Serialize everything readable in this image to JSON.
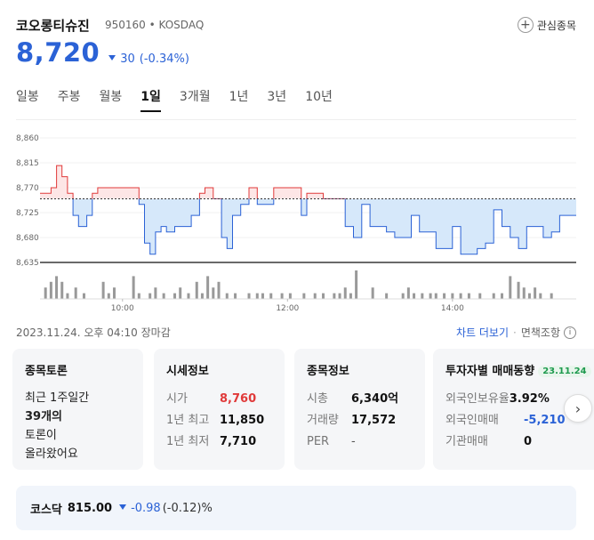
{
  "stock": {
    "name": "코오롱티슈진",
    "code_market": "950160 • KOSDAQ",
    "price": "8,720",
    "change": "30",
    "change_pct": "(-0.34%)",
    "direction": "down",
    "watch_label": "관심종목"
  },
  "period_tabs": [
    "일봉",
    "주봉",
    "월봉",
    "1일",
    "3개월",
    "1년",
    "3년",
    "10년"
  ],
  "active_tab": "1일",
  "meta": {
    "timestamp": "2023.11.24. 오후 04:10 장마감",
    "chart_link": "차트 더보기",
    "disclaimer": "면책조항"
  },
  "colors": {
    "up": "#e03a3a",
    "down": "#2b62d6",
    "up_fill": "#fde6e6",
    "down_fill": "#d6e8fa"
  },
  "chart_data": {
    "type": "line",
    "y_ticks": [
      "8,860",
      "8,815",
      "8,770",
      "8,725",
      "8,680",
      "8,635"
    ],
    "x_ticks": [
      "10:00",
      "12:00",
      "14:00"
    ],
    "ylim": [
      8635,
      8860
    ],
    "baseline": 8750,
    "x_range": [
      0,
      390
    ],
    "price_points": [
      [
        0,
        8760
      ],
      [
        8,
        8770
      ],
      [
        12,
        8810
      ],
      [
        16,
        8790
      ],
      [
        20,
        8760
      ],
      [
        24,
        8720
      ],
      [
        28,
        8700
      ],
      [
        34,
        8720
      ],
      [
        38,
        8760
      ],
      [
        42,
        8770
      ],
      [
        50,
        8770
      ],
      [
        60,
        8770
      ],
      [
        70,
        8770
      ],
      [
        72,
        8740
      ],
      [
        76,
        8670
      ],
      [
        80,
        8650
      ],
      [
        84,
        8690
      ],
      [
        88,
        8700
      ],
      [
        92,
        8690
      ],
      [
        98,
        8700
      ],
      [
        104,
        8700
      ],
      [
        110,
        8720
      ],
      [
        116,
        8760
      ],
      [
        120,
        8770
      ],
      [
        126,
        8750
      ],
      [
        132,
        8680
      ],
      [
        136,
        8660
      ],
      [
        140,
        8720
      ],
      [
        146,
        8740
      ],
      [
        152,
        8770
      ],
      [
        158,
        8740
      ],
      [
        164,
        8740
      ],
      [
        170,
        8770
      ],
      [
        178,
        8770
      ],
      [
        186,
        8770
      ],
      [
        190,
        8720
      ],
      [
        194,
        8760
      ],
      [
        200,
        8760
      ],
      [
        206,
        8750
      ],
      [
        214,
        8750
      ],
      [
        222,
        8700
      ],
      [
        228,
        8680
      ],
      [
        234,
        8740
      ],
      [
        240,
        8700
      ],
      [
        246,
        8700
      ],
      [
        252,
        8690
      ],
      [
        258,
        8680
      ],
      [
        264,
        8680
      ],
      [
        270,
        8720
      ],
      [
        276,
        8690
      ],
      [
        282,
        8690
      ],
      [
        288,
        8660
      ],
      [
        294,
        8660
      ],
      [
        300,
        8700
      ],
      [
        306,
        8650
      ],
      [
        312,
        8650
      ],
      [
        318,
        8660
      ],
      [
        324,
        8670
      ],
      [
        330,
        8730
      ],
      [
        336,
        8700
      ],
      [
        342,
        8680
      ],
      [
        348,
        8660
      ],
      [
        354,
        8700
      ],
      [
        360,
        8700
      ],
      [
        366,
        8680
      ],
      [
        372,
        8690
      ],
      [
        378,
        8720
      ],
      [
        384,
        8720
      ],
      [
        390,
        8720
      ]
    ],
    "volume_x": [
      4,
      8,
      12,
      16,
      20,
      26,
      32,
      46,
      50,
      54,
      68,
      72,
      80,
      84,
      90,
      98,
      102,
      108,
      114,
      118,
      122,
      126,
      130,
      136,
      142,
      152,
      158,
      162,
      168,
      176,
      182,
      192,
      200,
      206,
      214,
      218,
      222,
      226,
      230,
      242,
      252,
      264,
      268,
      272,
      278,
      284,
      288,
      294,
      300,
      306,
      312,
      320,
      330,
      336,
      342,
      348,
      352,
      356,
      360,
      364,
      372
    ],
    "volume_values": [
      2,
      3,
      4,
      3,
      1,
      2,
      1,
      3,
      1,
      2,
      4,
      1,
      1,
      2,
      1,
      1,
      2,
      1,
      3,
      1,
      4,
      2,
      3,
      1,
      1,
      1,
      1,
      1,
      1,
      1,
      1,
      1,
      1,
      1,
      1,
      1,
      2,
      1,
      5,
      2,
      1,
      1,
      2,
      1,
      1,
      1,
      1,
      1,
      1,
      1,
      1,
      1,
      1,
      1,
      4,
      3,
      2,
      1,
      2,
      1,
      1
    ]
  },
  "cards": {
    "discussion": {
      "title": "종목토론",
      "line1": "최근 1주일간",
      "line2_bold": "39개의",
      "line3": "토론이",
      "line4": "올라왔어요"
    },
    "quote": {
      "title": "시세정보",
      "open_label": "시가",
      "open_value": "8,760",
      "high_label": "1년 최고",
      "high_value": "11,850",
      "low_label": "1년 최저",
      "low_value": "7,710"
    },
    "info": {
      "title": "종목정보",
      "mcap_label": "시총",
      "mcap_value": "6,340억",
      "volume_label": "거래량",
      "volume_value": "17,572",
      "per_label": "PER",
      "per_value": "-"
    },
    "investor": {
      "title": "투자자별 매매동향",
      "date_badge": "23.11.24",
      "foreign_ratio_label": "외국인보유율",
      "foreign_ratio_value": "3.92%",
      "foreign_trade_label": "외국인매매",
      "foreign_trade_value": "-5,210",
      "inst_trade_label": "기관매매",
      "inst_trade_value": "0"
    }
  },
  "index_bar": {
    "name": "코스닥",
    "value": "815.00",
    "change": "-0.98",
    "change_pct": "(-0.12)%"
  }
}
